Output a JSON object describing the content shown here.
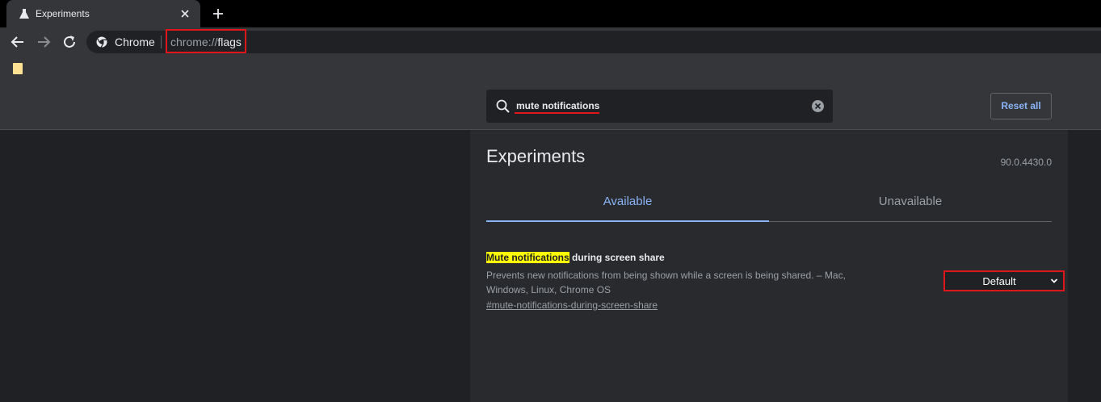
{
  "tab": {
    "title": "Experiments"
  },
  "toolbar": {
    "omnibox_label": "Chrome",
    "url_scheme": "chrome://",
    "url_host": "flags"
  },
  "flags": {
    "search_value": "mute notifications",
    "reset_label": "Reset all",
    "page_title": "Experiments",
    "version": "90.0.4430.0",
    "tabs": [
      {
        "label": "Available",
        "active": true
      },
      {
        "label": "Unavailable",
        "active": false
      }
    ],
    "experiment": {
      "title_highlight": "Mute notifications",
      "title_rest": " during screen share",
      "description": "Prevents new notifications from being shown while a screen is being shared. – Mac, Windows, Linux, Chrome OS",
      "link": "#mute-notifications-during-screen-share",
      "selected_option": "Default"
    }
  },
  "icons": {
    "tab": "flask-icon",
    "close": "close-icon",
    "new_tab": "plus-icon",
    "back": "back-arrow-icon",
    "forward": "forward-arrow-icon",
    "reload": "reload-icon",
    "site": "chrome-logo-icon",
    "bookmark": "folder-icon",
    "search": "search-icon",
    "clear": "clear-icon",
    "dropdown": "chevron-down-icon"
  },
  "colors": {
    "accent": "#8ab4f8",
    "highlight": "#ffff00",
    "annotation": "#e0161a",
    "background": "#202124"
  }
}
